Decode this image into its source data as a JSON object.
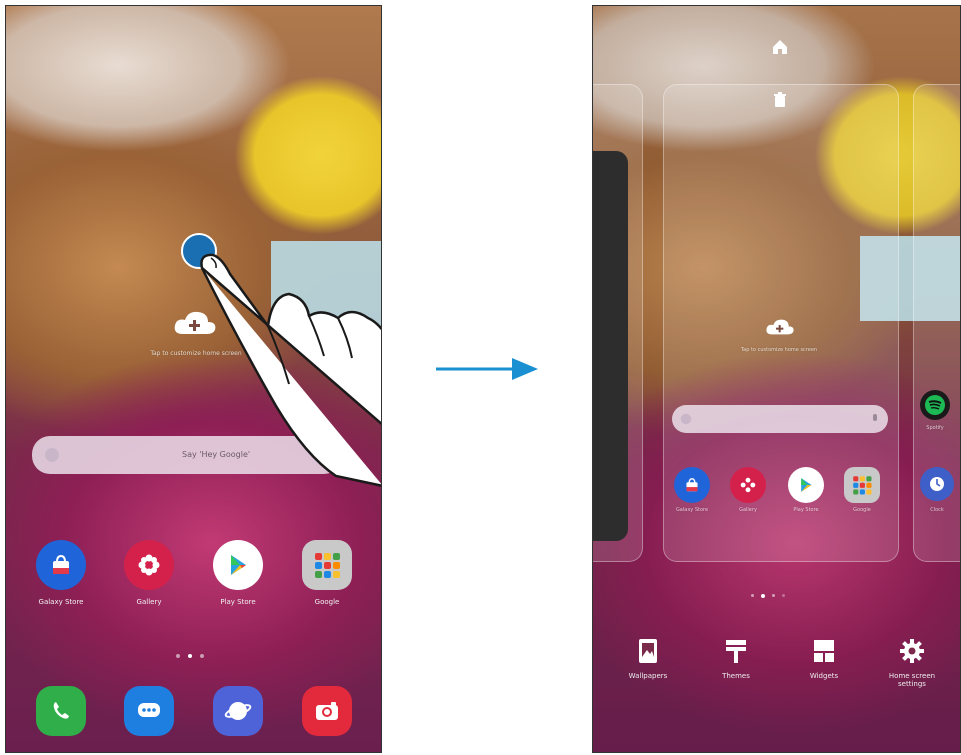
{
  "left_screen": {
    "home_hint": "Tap to customize home screen",
    "search_placeholder": "Say 'Hey Google'",
    "apps": [
      {
        "label": "Galaxy Store",
        "icon": "shopping-bag-icon",
        "color": "#1f64d8"
      },
      {
        "label": "Gallery",
        "icon": "flower-icon",
        "color": "#d4214b"
      },
      {
        "label": "Play Store",
        "icon": "play-store-icon",
        "color": "#ffffff"
      },
      {
        "label": "Google",
        "icon": "google-folder-icon",
        "color": "#c9c9c9"
      }
    ],
    "dock": [
      {
        "icon": "phone-icon",
        "color": "#2fae4a"
      },
      {
        "icon": "messages-icon",
        "color": "#1f7fe0"
      },
      {
        "icon": "internet-icon",
        "color": "#4f63d8"
      },
      {
        "icon": "camera-icon",
        "color": "#e22a3c"
      }
    ]
  },
  "right_screen": {
    "home_hint": "Tap to customize home screen",
    "apps": [
      {
        "label": "Galaxy Store",
        "icon": "shopping-bag-icon",
        "color": "#1f64d8"
      },
      {
        "label": "Gallery",
        "icon": "flower-icon",
        "color": "#d4214b"
      },
      {
        "label": "Play Store",
        "icon": "play-store-icon",
        "color": "#ffffff"
      },
      {
        "label": "Google",
        "icon": "google-folder-icon",
        "color": "#c9c9c9"
      }
    ],
    "side_apps": [
      {
        "label": "Spotify",
        "icon": "spotify-icon",
        "color": "#1db954"
      },
      {
        "label": "Clock",
        "icon": "clock-icon",
        "color": "#3e5fc7"
      }
    ],
    "toolbar": [
      {
        "label": "Wallpapers",
        "icon": "wallpaper-icon"
      },
      {
        "label": "Themes",
        "icon": "brush-icon"
      },
      {
        "label": "Widgets",
        "icon": "widgets-icon"
      },
      {
        "label": "Home screen settings",
        "icon": "settings-icon"
      }
    ]
  },
  "colors": {
    "touch_dot": "#1a6fb3",
    "arrow": "#1a8fd1"
  }
}
